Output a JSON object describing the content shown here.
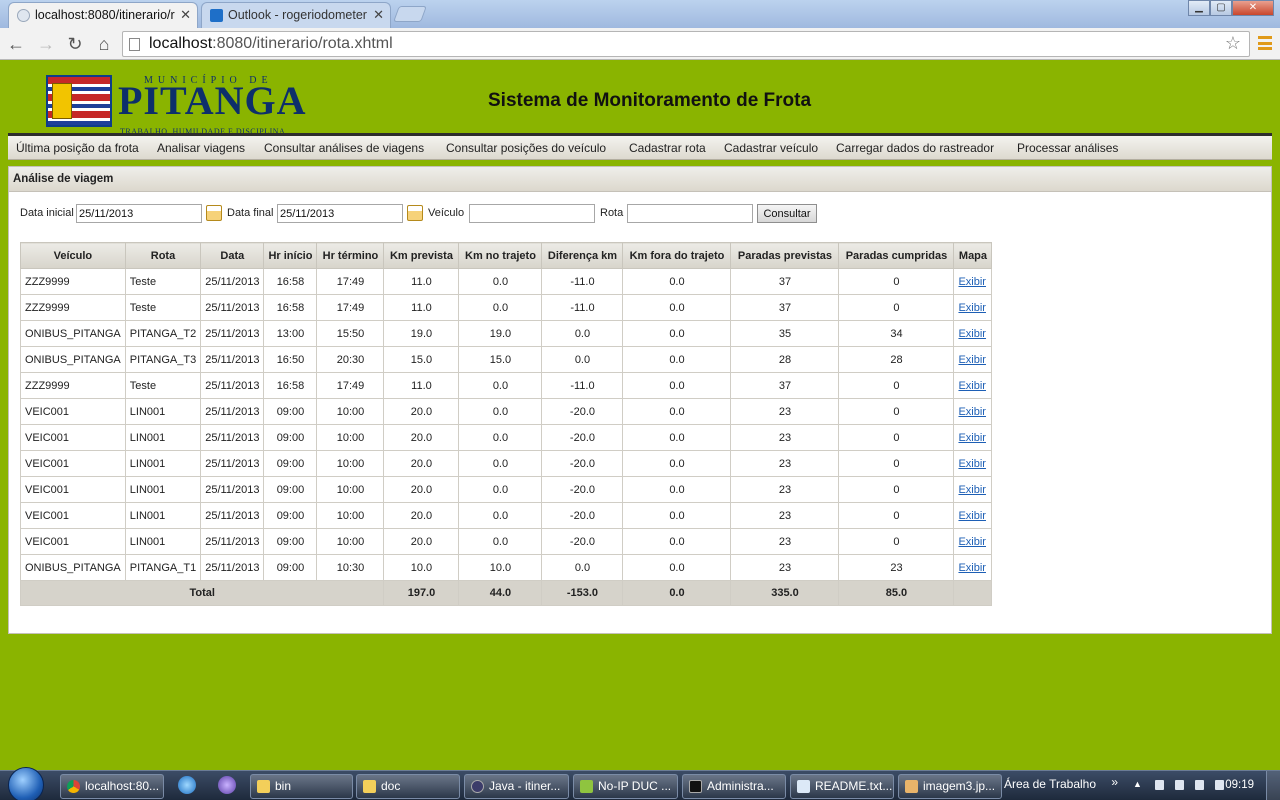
{
  "browser": {
    "tabs": [
      {
        "title": "localhost:8080/itinerario/r"
      },
      {
        "title": "Outlook - rogeriodometer"
      }
    ],
    "url_host": "localhost",
    "url_rest": ":8080/itinerario/rota.xhtml",
    "controls": {
      "minimize": "▁",
      "maximize": "▢",
      "close": "✕",
      "back": "←",
      "forward": "→",
      "reload": "↻",
      "home": "⌂",
      "star": "☆",
      "tab_close": "✕"
    }
  },
  "header": {
    "logo_small": "MUNICÍPIO DE",
    "logo_big": "PITANGA",
    "logo_motto": "TRABALHO, HUMILDADE E DISCIPLINA.",
    "title": "Sistema de Monitoramento de Frota"
  },
  "menu": [
    {
      "label": "Última posição da frota"
    },
    {
      "label": "Analisar viagens"
    },
    {
      "label": "Consultar análises de viagens"
    },
    {
      "label": "Consultar posições do veículo"
    },
    {
      "label": "Cadastrar rota"
    },
    {
      "label": "Cadastrar veículo"
    },
    {
      "label": "Carregar dados do rastreador"
    },
    {
      "label": "Processar análises"
    }
  ],
  "panel": {
    "title": "Análise de viagem"
  },
  "filters": {
    "start_label": "Data inicial",
    "start_value": "25/11/2013",
    "end_label": "Data final",
    "end_value": "25/11/2013",
    "vehicle_label": "Veículo",
    "vehicle_value": "",
    "route_label": "Rota",
    "route_value": "",
    "submit_label": "Consultar"
  },
  "table": {
    "columns": [
      "Veículo",
      "Rota",
      "Data",
      "Hr início",
      "Hr término",
      "Km prevista",
      "Km no trajeto",
      "Diferença km",
      "Km fora do trajeto",
      "Paradas previstas",
      "Paradas cumpridas",
      "Mapa"
    ],
    "rows": [
      [
        "ZZZ9999",
        "Teste",
        "25/11/2013",
        "16:58",
        "17:49",
        "11.0",
        "0.0",
        "-11.0",
        "0.0",
        "37",
        "0",
        "Exibir"
      ],
      [
        "ZZZ9999",
        "Teste",
        "25/11/2013",
        "16:58",
        "17:49",
        "11.0",
        "0.0",
        "-11.0",
        "0.0",
        "37",
        "0",
        "Exibir"
      ],
      [
        "ONIBUS_PITANGA",
        "PITANGA_T2",
        "25/11/2013",
        "13:00",
        "15:50",
        "19.0",
        "19.0",
        "0.0",
        "0.0",
        "35",
        "34",
        "Exibir"
      ],
      [
        "ONIBUS_PITANGA",
        "PITANGA_T3",
        "25/11/2013",
        "16:50",
        "20:30",
        "15.0",
        "15.0",
        "0.0",
        "0.0",
        "28",
        "28",
        "Exibir"
      ],
      [
        "ZZZ9999",
        "Teste",
        "25/11/2013",
        "16:58",
        "17:49",
        "11.0",
        "0.0",
        "-11.0",
        "0.0",
        "37",
        "0",
        "Exibir"
      ],
      [
        "VEIC001",
        "LIN001",
        "25/11/2013",
        "09:00",
        "10:00",
        "20.0",
        "0.0",
        "-20.0",
        "0.0",
        "23",
        "0",
        "Exibir"
      ],
      [
        "VEIC001",
        "LIN001",
        "25/11/2013",
        "09:00",
        "10:00",
        "20.0",
        "0.0",
        "-20.0",
        "0.0",
        "23",
        "0",
        "Exibir"
      ],
      [
        "VEIC001",
        "LIN001",
        "25/11/2013",
        "09:00",
        "10:00",
        "20.0",
        "0.0",
        "-20.0",
        "0.0",
        "23",
        "0",
        "Exibir"
      ],
      [
        "VEIC001",
        "LIN001",
        "25/11/2013",
        "09:00",
        "10:00",
        "20.0",
        "0.0",
        "-20.0",
        "0.0",
        "23",
        "0",
        "Exibir"
      ],
      [
        "VEIC001",
        "LIN001",
        "25/11/2013",
        "09:00",
        "10:00",
        "20.0",
        "0.0",
        "-20.0",
        "0.0",
        "23",
        "0",
        "Exibir"
      ],
      [
        "VEIC001",
        "LIN001",
        "25/11/2013",
        "09:00",
        "10:00",
        "20.0",
        "0.0",
        "-20.0",
        "0.0",
        "23",
        "0",
        "Exibir"
      ],
      [
        "ONIBUS_PITANGA",
        "PITANGA_T1",
        "25/11/2013",
        "09:00",
        "10:30",
        "10.0",
        "10.0",
        "0.0",
        "0.0",
        "23",
        "23",
        "Exibir"
      ]
    ],
    "total": {
      "label": "Total",
      "km_prevista": "197.0",
      "km_trajeto": "44.0",
      "diferenca": "-153.0",
      "km_fora": "0.0",
      "paradas_previstas": "335.0",
      "paradas_cumpridas": "85.0"
    }
  },
  "taskbar": {
    "items": [
      {
        "label": "localhost:80..."
      },
      {
        "label": "bin"
      },
      {
        "label": "doc"
      },
      {
        "label": "Java - itiner..."
      },
      {
        "label": "No-IP DUC ..."
      },
      {
        "label": "Administra..."
      },
      {
        "label": "README.txt..."
      },
      {
        "label": "imagem3.jp..."
      }
    ],
    "desktop_label": "Área de Trabalho",
    "chevron": "»",
    "tray_arrow": "▲",
    "clock": "09:19"
  },
  "colors": {
    "page_bg": "#8ab400",
    "link": "#1d5fb5",
    "accent": "#e09a1a"
  }
}
